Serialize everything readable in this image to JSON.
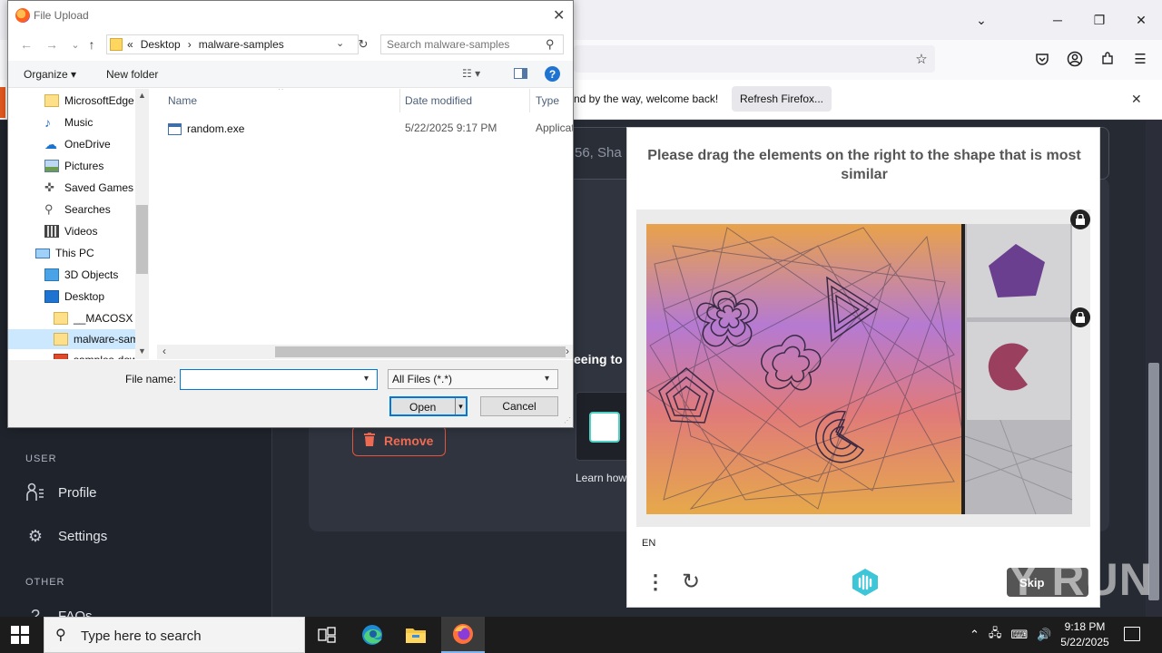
{
  "firefox": {
    "notification_message": "nd by the way, welcome back!",
    "refresh_button": "Refresh Firefox..."
  },
  "page": {
    "top_card_text": "56, Sha",
    "agree_text": "eeing to",
    "learn_how": "Learn how",
    "remove_button": "Remove",
    "sidebar": {
      "user_header": "USER",
      "profile": "Profile",
      "settings": "Settings",
      "other_header": "OTHER",
      "faqs": "FAQs"
    }
  },
  "captcha": {
    "prompt": "Please drag the elements on the right to the shape that is most similar",
    "language": "EN",
    "skip": "Skip"
  },
  "watermark": "ANY RUN",
  "dialog": {
    "title": "File Upload",
    "breadcrumb": [
      "«",
      "Desktop",
      "›",
      "malware-samples"
    ],
    "search_placeholder": "Search malware-samples",
    "toolbar": {
      "organize": "Organize ▾",
      "new_folder": "New folder"
    },
    "nav_items": [
      {
        "label": "MicrosoftEdge",
        "icon": "folder-icon"
      },
      {
        "label": "Music",
        "icon": "music-icon"
      },
      {
        "label": "OneDrive",
        "icon": "cloud-icon"
      },
      {
        "label": "Pictures",
        "icon": "pictures-icon"
      },
      {
        "label": "Saved Games",
        "icon": "games-icon"
      },
      {
        "label": "Searches",
        "icon": "search-icon"
      },
      {
        "label": "Videos",
        "icon": "video-icon"
      },
      {
        "label": "This PC",
        "icon": "computer-icon"
      },
      {
        "label": "3D Objects",
        "icon": "cube-icon"
      },
      {
        "label": "Desktop",
        "icon": "desktop-icon"
      },
      {
        "label": "__MACOSX",
        "icon": "folder-icon"
      },
      {
        "label": "malware-samples",
        "icon": "folder-icon"
      },
      {
        "label": "samples-dow",
        "icon": "folder-icon"
      }
    ],
    "columns": {
      "name": "Name",
      "date": "Date modified",
      "type": "Type"
    },
    "files": [
      {
        "name": "random.exe",
        "date": "5/22/2025 9:17 PM",
        "type": "Applicat"
      }
    ],
    "file_name_label": "File name:",
    "file_name_value": "",
    "filter": "All Files (*.*)",
    "open_button": "Open",
    "cancel_button": "Cancel"
  },
  "taskbar": {
    "search_placeholder": "Type here to search",
    "time": "9:18 PM",
    "date": "5/22/2025"
  }
}
